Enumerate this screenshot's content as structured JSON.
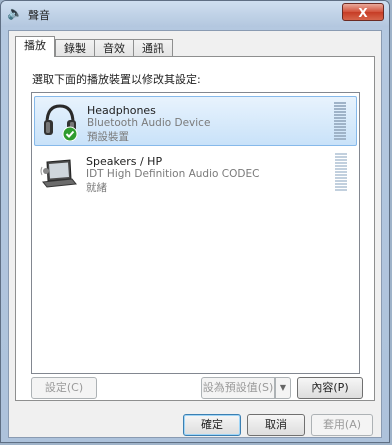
{
  "window": {
    "title": "聲音",
    "close_label": "X"
  },
  "tabs": [
    {
      "label": "播放",
      "active": true
    },
    {
      "label": "錄製",
      "active": false
    },
    {
      "label": "音效",
      "active": false
    },
    {
      "label": "通訊",
      "active": false
    }
  ],
  "instruction": "選取下面的播放裝置以修改其設定:",
  "devices": [
    {
      "name": "Headphones",
      "description": "Bluetooth Audio Device",
      "status": "預設裝置",
      "icon": "headphones-icon",
      "selected": true
    },
    {
      "name": "Speakers / HP",
      "description": "IDT High Definition Audio CODEC",
      "status": "就緒",
      "icon": "laptop-speakers-icon",
      "selected": false
    }
  ],
  "panel_buttons": {
    "configure": "設定(C)",
    "set_default": "設為預設值(S)",
    "properties": "內容(P)"
  },
  "dialog_buttons": {
    "ok": "確定",
    "cancel": "取消",
    "apply": "套用(A)"
  }
}
